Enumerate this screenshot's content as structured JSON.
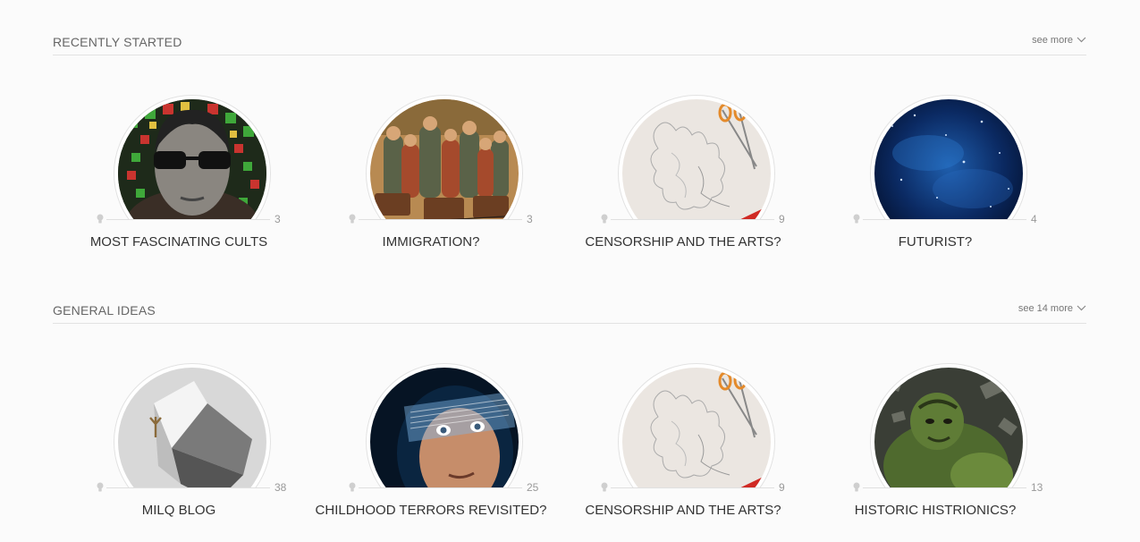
{
  "sections": [
    {
      "title": "RECENTLY STARTED",
      "see_more": "see more",
      "cards": [
        {
          "title": "MOST FASCINATING CULTS",
          "count": "3",
          "image": "portrait-sunglasses"
        },
        {
          "title": "IMMIGRATION?",
          "count": "3",
          "image": "immigrants-painting"
        },
        {
          "title": "CENSORSHIP AND THE ARTS?",
          "count": "9",
          "image": "sketch-scissors"
        },
        {
          "title": "FUTURIST?",
          "count": "4",
          "image": "starfield-nebula"
        }
      ]
    },
    {
      "title": "GENERAL IDEAS",
      "see_more": "see 14 more",
      "cards": [
        {
          "title": "MILQ BLOG",
          "count": "38",
          "image": "paper-sculpture"
        },
        {
          "title": "CHILDHOOD TERRORS REVISITED?",
          "count": "25",
          "image": "astronaut-visor"
        },
        {
          "title": "CENSORSHIP AND THE ARTS?",
          "count": "9",
          "image": "sketch-scissors"
        },
        {
          "title": "HISTORIC HISTRIONICS?",
          "count": "13",
          "image": "green-hulk"
        }
      ]
    }
  ]
}
